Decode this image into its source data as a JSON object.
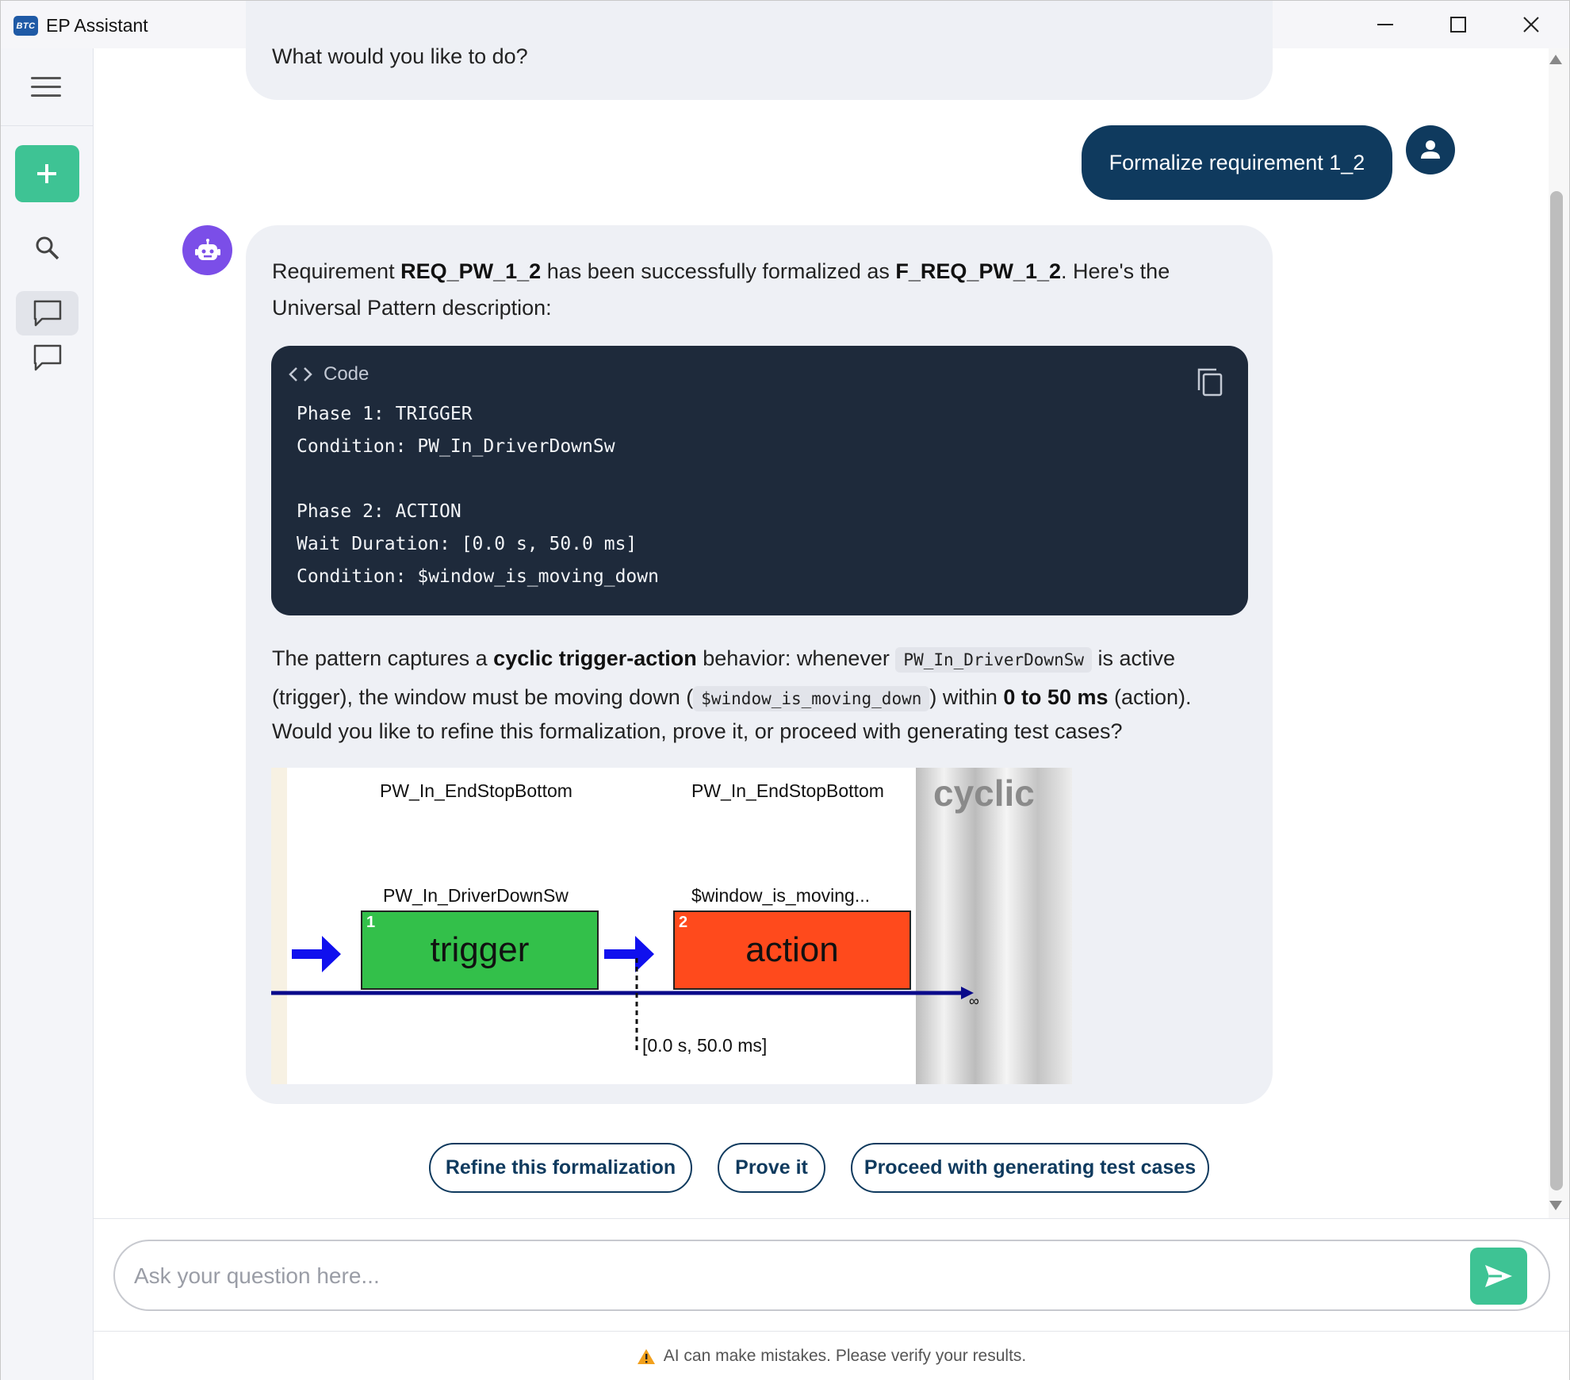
{
  "window": {
    "logo_text": "BTC",
    "title": "EP Assistant"
  },
  "chat": {
    "previous_message_tail": "What would you like to do?",
    "user_message": "Formalize requirement 1_2",
    "bot": {
      "intro_parts": [
        "Requirement ",
        "REQ_PW_1_2",
        " has been successfully formalized as ",
        "F_REQ_PW_1_2",
        ". Here's the Universal Pattern description:"
      ],
      "code": {
        "header_label": "Code",
        "content": "Phase 1: TRIGGER\nCondition: PW_In_DriverDownSw\n\nPhase 2: ACTION\nWait Duration: [0.0 s, 50.0 ms]\nCondition: $window_is_moving_down"
      },
      "explanation": {
        "t1": "The pattern captures a ",
        "b1": "cyclic trigger-action",
        "t2": " behavior: whenever ",
        "c1": "PW_In_DriverDownSw",
        "t3": " is active (trigger), the window must be moving down (",
        "c2": "$window_is_moving_down",
        "t4": ") within ",
        "b2": "0 to 50 ms",
        "t5": " (action)."
      },
      "question": "Would you like to refine this formalization, prove it, or proceed with generating test cases?",
      "diagram": {
        "top_label_1": "PW_In_EndStopBottom",
        "top_label_2": "PW_In_EndStopBottom",
        "trigger_condition": "PW_In_DriverDownSw",
        "action_condition": "$window_is_moving...",
        "trigger_num": "1",
        "trigger_text": "trigger",
        "action_num": "2",
        "action_text": "action",
        "wait_label": "[0.0 s, 50.0 ms]",
        "infinity": "∞",
        "cyclic": "cyclic"
      }
    },
    "actions": {
      "refine": "Refine this formalization",
      "prove": "Prove it",
      "proceed": "Proceed with generating test cases"
    }
  },
  "input": {
    "placeholder": "Ask your question here..."
  },
  "footer": {
    "warning": "AI can make mistakes. Please verify your results."
  },
  "colors": {
    "accent_green": "#3ec394",
    "user_bubble": "#0f3a5e",
    "bot_avatar": "#7b4ee8",
    "code_bg": "#1e2a3b",
    "trigger_green": "#33c04a",
    "action_red": "#ff4a1c"
  },
  "icons": [
    "menu-icon",
    "plus-icon",
    "search-icon",
    "chat-icon",
    "user-icon",
    "robot-icon",
    "code-icon",
    "copy-icon",
    "send-icon",
    "warning-icon"
  ]
}
